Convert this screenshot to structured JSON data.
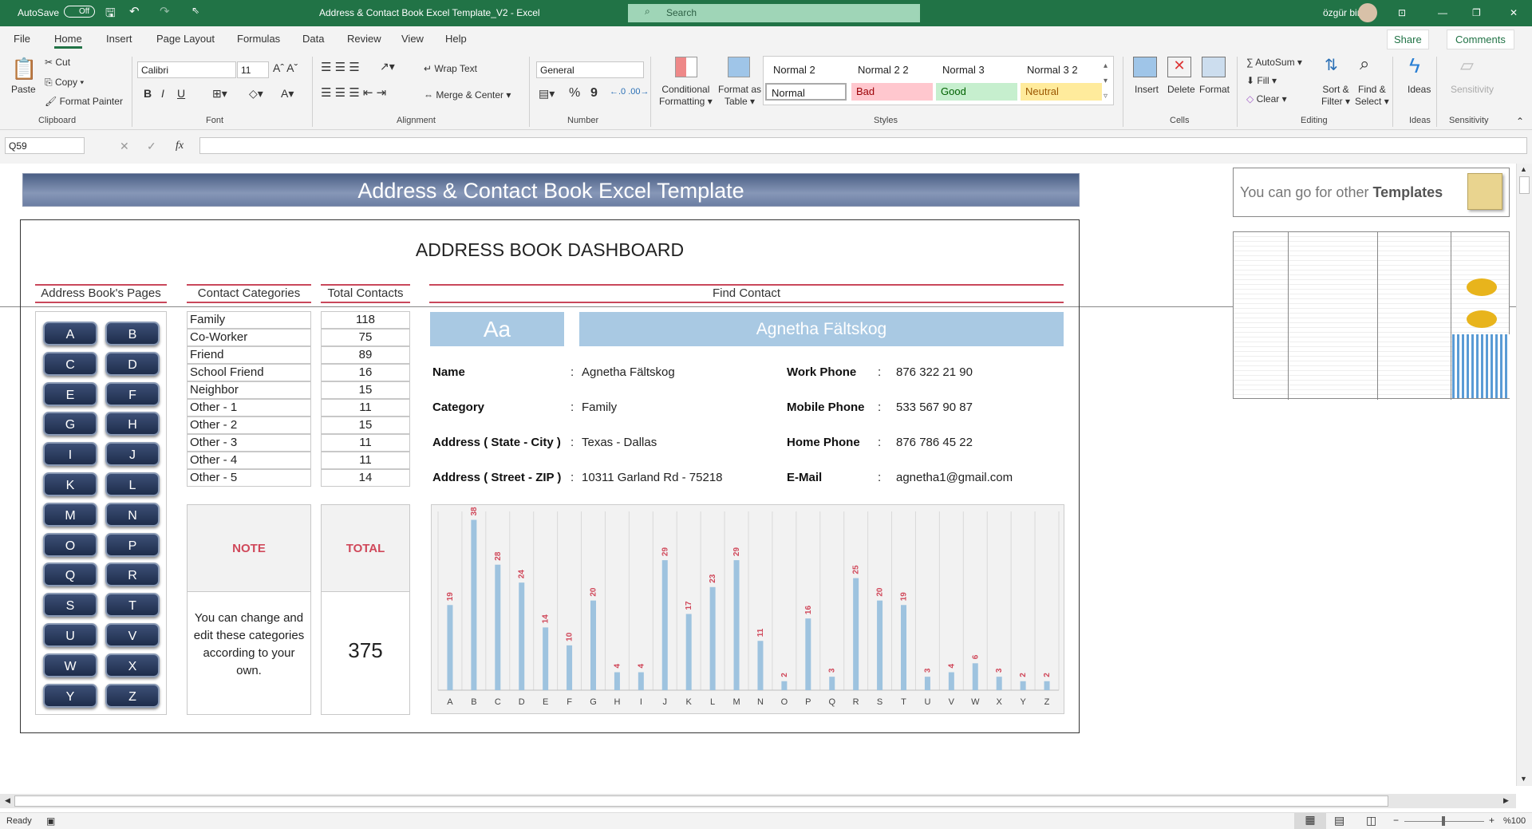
{
  "titlebar": {
    "autosave": "AutoSave",
    "autosave_state": "Off",
    "title": "Address & Contact Book Excel Template_V2  -  Excel",
    "search": "Search",
    "user": "özgür bircan"
  },
  "tabs": [
    "File",
    "Home",
    "Insert",
    "Page Layout",
    "Formulas",
    "Data",
    "Review",
    "View",
    "Help"
  ],
  "share": "Share",
  "comments": "Comments",
  "ribbon": {
    "clipboard": {
      "paste": "Paste",
      "cut": "Cut",
      "copy": "Copy",
      "format_painter": "Format Painter",
      "group": "Clipboard"
    },
    "font": {
      "name": "Calibri",
      "size": "11",
      "group": "Font",
      "bold": "B",
      "italic": "I",
      "underline": "U"
    },
    "alignment": {
      "wrap": "Wrap Text",
      "merge": "Merge & Center",
      "group": "Alignment"
    },
    "number": {
      "format": "General",
      "group": "Number",
      "percent": "%",
      "comma": "9"
    },
    "styles": {
      "cond1": "Conditional",
      "cond2": "Formatting",
      "fmt1": "Format as",
      "fmt2": "Table",
      "cells": [
        "Normal 2",
        "Normal 2 2",
        "Normal 3",
        "Normal 3 2",
        "Normal",
        "Bad",
        "Good",
        "Neutral"
      ],
      "group": "Styles"
    },
    "cells": {
      "insert": "Insert",
      "delete": "Delete",
      "format": "Format",
      "group": "Cells"
    },
    "editing": {
      "autosum": "AutoSum",
      "fill": "Fill",
      "clear": "Clear",
      "sort1": "Sort &",
      "sort2": "Filter",
      "find1": "Find &",
      "find2": "Select",
      "group": "Editing"
    },
    "ideas": {
      "label": "Ideas",
      "group": "Ideas"
    },
    "sensitivity": {
      "label": "Sensitivity",
      "group": "Sensitivity"
    }
  },
  "formula_bar": {
    "name_box": "Q59",
    "fx": "fx",
    "value": ""
  },
  "sheet": {
    "banner": "Address & Contact Book Excel Template",
    "dashboard_title": "ADDRESS BOOK DASHBOARD",
    "headers": {
      "pages": "Address Book's Pages",
      "categories": "Contact Categories",
      "totals": "Total Contacts",
      "find": "Find Contact"
    },
    "letters": [
      "A",
      "B",
      "C",
      "D",
      "E",
      "F",
      "G",
      "H",
      "I",
      "J",
      "K",
      "L",
      "M",
      "N",
      "O",
      "P",
      "Q",
      "R",
      "S",
      "T",
      "U",
      "V",
      "W",
      "X",
      "Y",
      "Z"
    ],
    "categories": [
      {
        "name": "Family",
        "count": "118"
      },
      {
        "name": "Co-Worker",
        "count": "75"
      },
      {
        "name": "Friend",
        "count": "89"
      },
      {
        "name": "School Friend",
        "count": "16"
      },
      {
        "name": "Neighbor",
        "count": "15"
      },
      {
        "name": "Other - 1",
        "count": "11"
      },
      {
        "name": "Other - 2",
        "count": "15"
      },
      {
        "name": "Other - 3",
        "count": "11"
      },
      {
        "name": "Other - 4",
        "count": "11"
      },
      {
        "name": "Other - 5",
        "count": "14"
      }
    ],
    "note_label": "NOTE",
    "note_text": "You can change and edit these categories according to your own.",
    "total_label": "TOTAL",
    "total_value": "375",
    "search_key": "Aa",
    "selected_name": "Agnetha Fältskog",
    "details_left": [
      {
        "label": "Name",
        "value": "Agnetha Fältskog"
      },
      {
        "label": "Category",
        "value": "Family"
      },
      {
        "label": "Address ( State - City )",
        "value": "Texas - Dallas"
      },
      {
        "label": "Address ( Street - ZIP )",
        "value": "10311 Garland Rd - 75218"
      }
    ],
    "details_right": [
      {
        "label": "Work Phone",
        "value": "876 322 21 90"
      },
      {
        "label": "Mobile Phone",
        "value": "533 567 90 87"
      },
      {
        "label": "Home Phone",
        "value": "876 786 45 22"
      },
      {
        "label": "E-Mail",
        "value": "agnetha1@gmail.com"
      }
    ],
    "colon": ":",
    "side_text": "You can go for other ",
    "side_bold": "Templates"
  },
  "chart_data": {
    "type": "bar",
    "categories": [
      "A",
      "B",
      "C",
      "D",
      "E",
      "F",
      "G",
      "H",
      "I",
      "J",
      "K",
      "L",
      "M",
      "N",
      "O",
      "P",
      "Q",
      "R",
      "S",
      "T",
      "U",
      "V",
      "W",
      "X",
      "Y",
      "Z"
    ],
    "values": [
      19,
      38,
      28,
      24,
      14,
      10,
      20,
      4,
      4,
      29,
      17,
      23,
      29,
      11,
      2,
      16,
      3,
      25,
      20,
      19,
      3,
      4,
      6,
      3,
      2,
      2
    ],
    "ylim": [
      0,
      40
    ],
    "bar_color": "#9ec3df",
    "label_color": "#d0485a"
  },
  "status": {
    "ready": "Ready",
    "zoom": "%100"
  }
}
